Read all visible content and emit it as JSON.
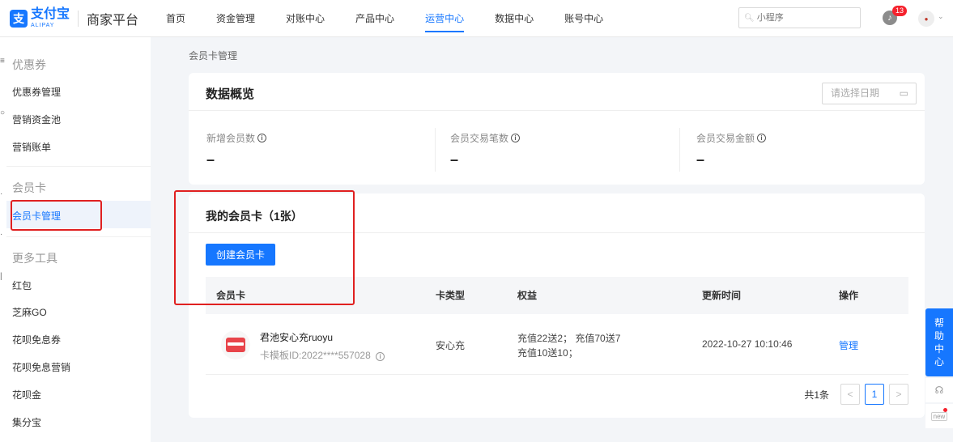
{
  "header": {
    "logo_mark": "支",
    "logo_cn": "支付宝",
    "logo_en": "ALIPAY",
    "platform": "商家平台",
    "nav": [
      "首页",
      "资金管理",
      "对账中心",
      "产品中心",
      "运营中心",
      "数据中心",
      "账号中心"
    ],
    "active_nav": "运营中心",
    "search_placeholder": "小程序",
    "notification_count": "13"
  },
  "sidebar": {
    "groups": [
      {
        "title": "优惠券",
        "items": [
          "优惠券管理",
          "营销资金池",
          "营销账单"
        ]
      },
      {
        "title": "会员卡",
        "items": [
          "会员卡管理"
        ]
      },
      {
        "title": "更多工具",
        "items": [
          "红包",
          "芝麻GO",
          "花呗免息券",
          "花呗免息营销",
          "花呗金",
          "集分宝"
        ]
      }
    ],
    "active_item": "会员卡管理"
  },
  "breadcrumb": "会员卡管理",
  "overview": {
    "title": "数据概览",
    "date_placeholder": "请选择日期",
    "stats": [
      {
        "label": "新增会员数",
        "value": "–"
      },
      {
        "label": "会员交易笔数",
        "value": "–"
      },
      {
        "label": "会员交易金额",
        "value": "–"
      }
    ]
  },
  "my_cards": {
    "title": "我的会员卡（1张）",
    "create_button": "创建会员卡",
    "columns": [
      "会员卡",
      "卡类型",
      "权益",
      "更新时间",
      "操作"
    ],
    "rows": [
      {
        "name": "君池安心充ruoyu",
        "template_id": "卡模板ID:2022****557028",
        "type": "安心充",
        "benefit_line1": "充值22送2； 充值70送7",
        "benefit_line2": "充值10送10；",
        "updated": "2022-10-27 10:10:46",
        "action": "管理"
      }
    ],
    "pagination": {
      "total": "共1条",
      "current_page": "1",
      "prev": "<",
      "next": ">"
    }
  },
  "help_widget": {
    "chars": [
      "帮",
      "助",
      "中",
      "心"
    ],
    "new_label": "new"
  },
  "colors": {
    "brand": "#1677ff",
    "annotation": "#e02020"
  }
}
